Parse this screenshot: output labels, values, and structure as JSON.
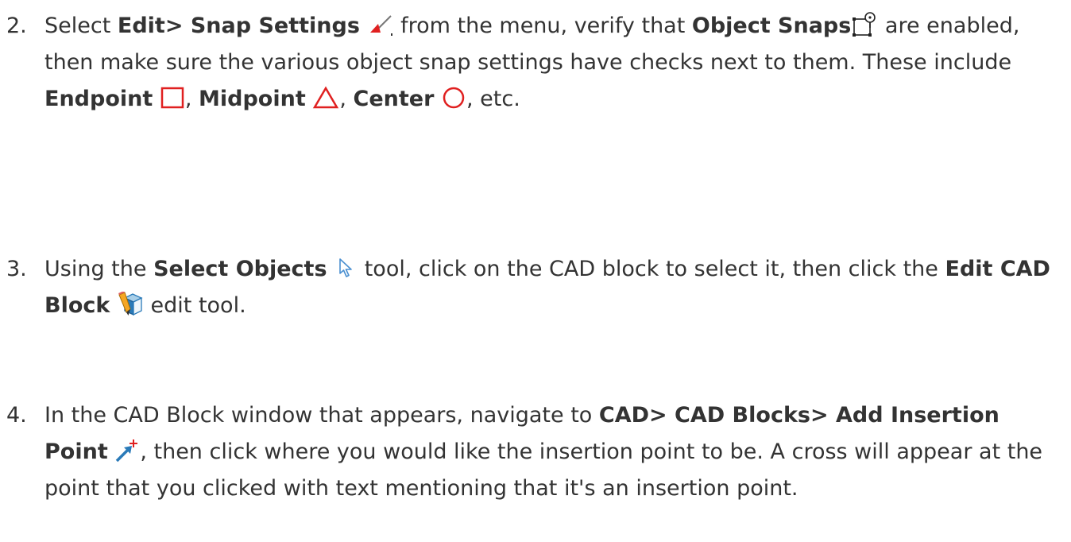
{
  "steps": [
    {
      "number": "2.",
      "t1": "Select ",
      "b1": "Edit> Snap Settings",
      "t2": " from the menu, verify that ",
      "b2": "Object Snaps",
      "t3": " are enabled, then make sure the various object snap settings have checks next to them. These include ",
      "b3": "Endpoint",
      "t4": ", ",
      "b4": "Midpoint",
      "t5": ", ",
      "b5": "Center",
      "t6": ", etc.",
      "icons": [
        "snap-settings-icon",
        "object-snaps-icon",
        "endpoint-icon",
        "midpoint-icon",
        "center-icon"
      ]
    },
    {
      "number": "3.",
      "t1": "Using the ",
      "b1": "Select Objects",
      "t2": " tool, click on the CAD block to select it, then click the ",
      "b2": "Edit CAD Block",
      "t3": " edit tool.",
      "icons": [
        "select-objects-icon",
        "edit-cad-block-icon"
      ]
    },
    {
      "number": "4.",
      "t1": "In the CAD Block window that appears, navigate to ",
      "b1": "CAD> CAD Blocks> Add Insertion Point",
      "t2": ", then click where you would like the insertion point to be. A cross will appear at the point that you clicked with text mentioning that it's an insertion point.",
      "icons": [
        "add-insertion-point-icon"
      ]
    }
  ],
  "colors": {
    "text": "#333333",
    "snap_red": "#e02020",
    "accent_blue": "#2a7ab8"
  }
}
